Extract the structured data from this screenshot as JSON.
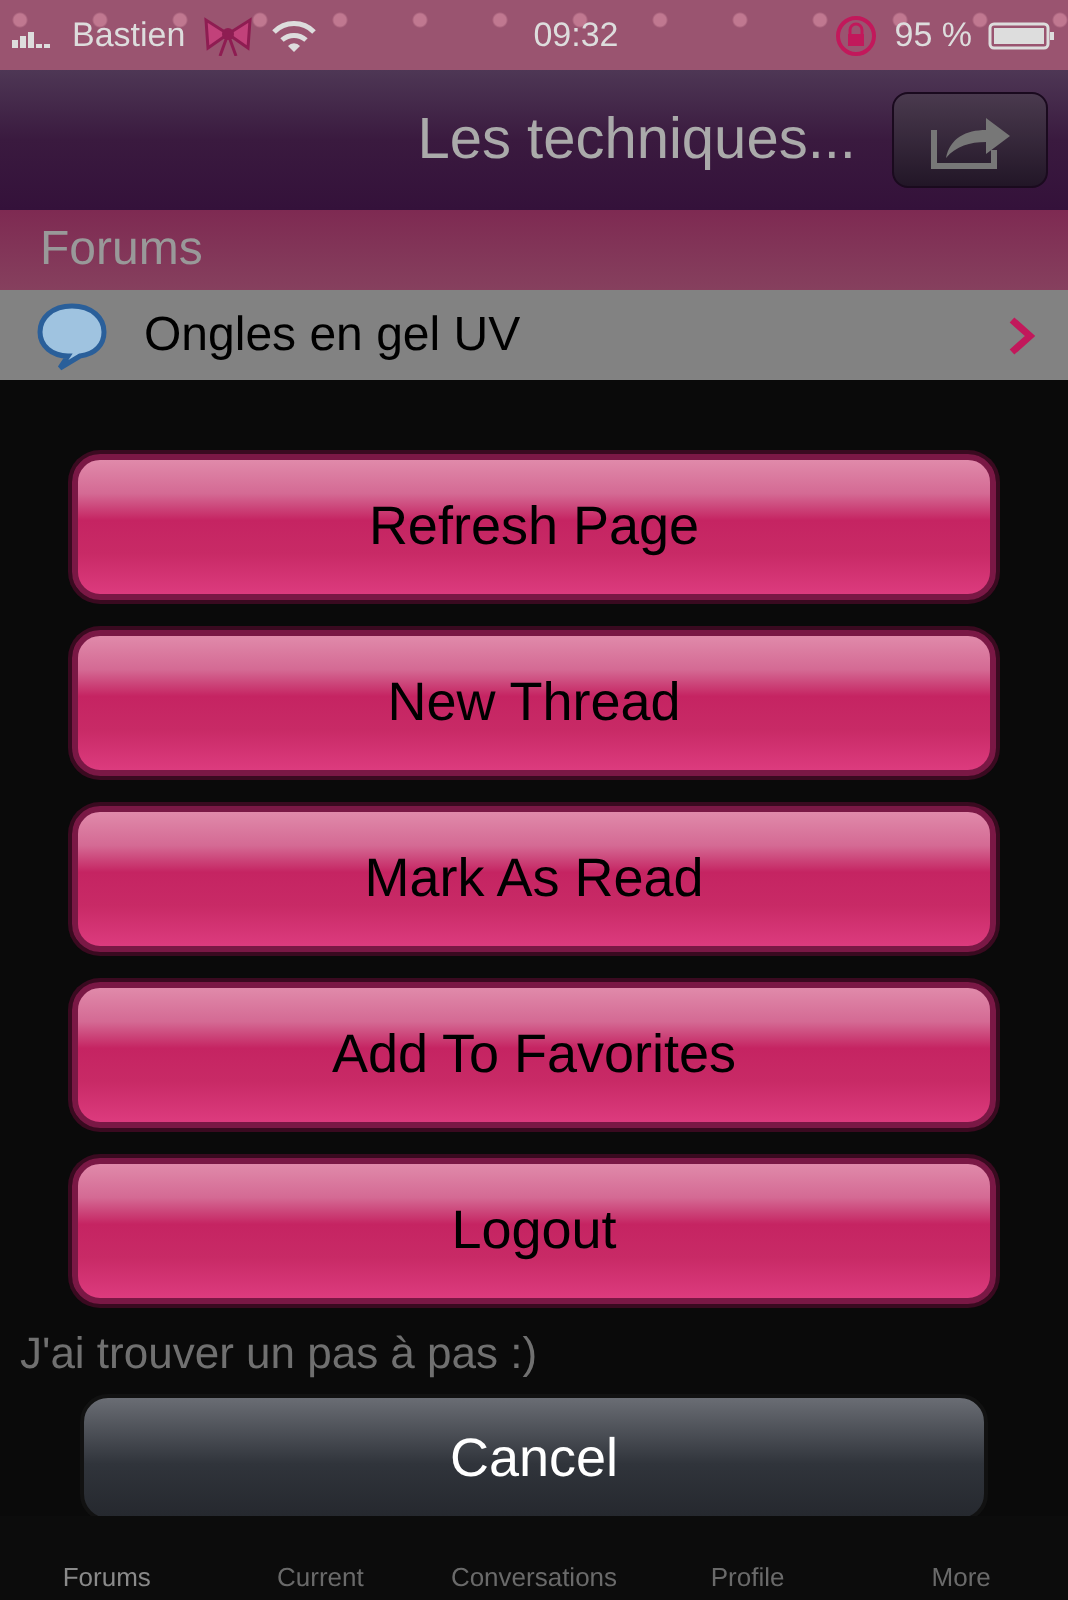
{
  "status_bar": {
    "carrier": "Bastien",
    "time": "09:32",
    "battery": "95 %"
  },
  "nav_bar": {
    "title": "Les techniques..."
  },
  "section_header": "Forums",
  "forum_rows": [
    {
      "title": "Ongles en gel UV"
    }
  ],
  "post_snippet": "J'ai trouver un pas à pas :)",
  "tab_bar": [
    {
      "label": "Forums",
      "selected": true
    },
    {
      "label": "Current",
      "selected": false
    },
    {
      "label": "Conversations",
      "selected": false
    },
    {
      "label": "Profile",
      "selected": false
    },
    {
      "label": "More",
      "selected": false
    }
  ],
  "action_sheet": [
    {
      "label": "Refresh Page",
      "kind": "action"
    },
    {
      "label": "New Thread",
      "kind": "action"
    },
    {
      "label": "Mark As Read",
      "kind": "action"
    },
    {
      "label": "Add To Favorites",
      "kind": "action"
    },
    {
      "label": "Logout",
      "kind": "action"
    },
    {
      "label": "Cancel",
      "kind": "cancel"
    }
  ]
}
